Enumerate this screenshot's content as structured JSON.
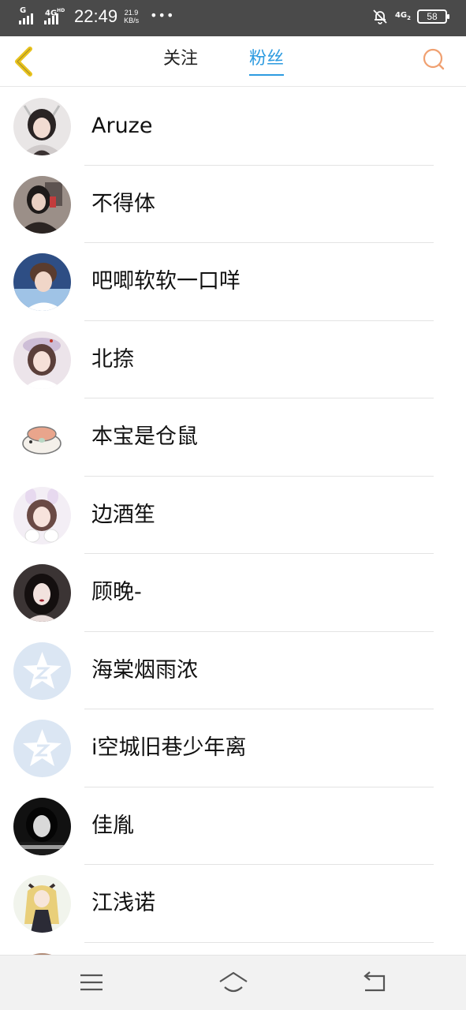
{
  "status_bar": {
    "network1": "G",
    "network2": "4G",
    "network2_sup": "HD",
    "time": "22:49",
    "speed_value": "21.9",
    "speed_unit": "KB/s",
    "more": "•••",
    "network3": "4G",
    "network3_sub": "2",
    "battery": "58"
  },
  "header": {
    "tabs": [
      {
        "label": "关注",
        "active": false
      },
      {
        "label": "粉丝",
        "active": true
      }
    ],
    "accent_color": "#2d9be0",
    "back_color": "#e8c21c",
    "search_color": "#f0a070"
  },
  "fans": [
    {
      "name": "Aruze",
      "avatar": "dark-hair-girl-avatar"
    },
    {
      "name": "不得体",
      "avatar": "selfie-girl-avatar"
    },
    {
      "name": "吧唧软软一口咩",
      "avatar": "boy-avatar"
    },
    {
      "name": "北捺",
      "avatar": "beret-girl-avatar"
    },
    {
      "name": "本宝是仓鼠",
      "avatar": "hamster-avatar"
    },
    {
      "name": "边酒笙",
      "avatar": "bunny-ears-girl-avatar"
    },
    {
      "name": "顾晚-",
      "avatar": "dark-hair-woman-avatar"
    },
    {
      "name": "海棠烟雨浓",
      "avatar": "default-qzone-avatar"
    },
    {
      "name": "i空城旧巷少年离",
      "avatar": "default-qzone-avatar"
    },
    {
      "name": "佳胤",
      "avatar": "black-white-girl-avatar"
    },
    {
      "name": "江浅诺",
      "avatar": "anime-girl-avatar"
    },
    {
      "name": "",
      "avatar": "partial-avatar"
    }
  ],
  "nav": {
    "menu_icon": "menu-icon",
    "home_icon": "home-icon",
    "back_icon": "back-icon"
  }
}
